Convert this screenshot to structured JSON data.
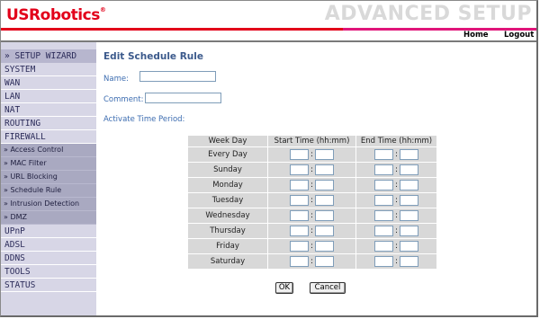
{
  "header": {
    "logo": "USRobotics",
    "logo_mark": "®",
    "banner": "ADVANCED SETUP",
    "home_label": "Home",
    "logout_label": "Logout"
  },
  "sidebar": {
    "wizard_label": "» SETUP WIZARD",
    "items": [
      {
        "label": "SYSTEM"
      },
      {
        "label": "WAN"
      },
      {
        "label": "LAN"
      },
      {
        "label": "NAT"
      },
      {
        "label": "ROUTING"
      },
      {
        "label": "FIREWALL"
      }
    ],
    "firewall_sub": [
      {
        "label": "» Access Control"
      },
      {
        "label": "» MAC Filter"
      },
      {
        "label": "» URL Blocking"
      },
      {
        "label": "» Schedule Rule"
      },
      {
        "label": "» Intrusion Detection"
      },
      {
        "label": "» DMZ"
      }
    ],
    "items_after": [
      {
        "label": "UPnP"
      },
      {
        "label": "ADSL"
      },
      {
        "label": "DDNS"
      },
      {
        "label": "TOOLS"
      },
      {
        "label": "STATUS"
      }
    ]
  },
  "form": {
    "title": "Edit Schedule Rule",
    "name_label": "Name:",
    "name_value": "",
    "comment_label": "Comment:",
    "comment_value": "",
    "period_label": "Activate Time Period:"
  },
  "schedule": {
    "headers": [
      "Week Day",
      "Start Time (hh:mm)",
      "End Time (hh:mm)"
    ],
    "rows": [
      "Every Day",
      "Sunday",
      "Monday",
      "Tuesday",
      "Wednesday",
      "Thursday",
      "Friday",
      "Saturday"
    ],
    "separator": ":"
  },
  "buttons": {
    "ok_label": "OK",
    "cancel_label": "Cancel"
  }
}
